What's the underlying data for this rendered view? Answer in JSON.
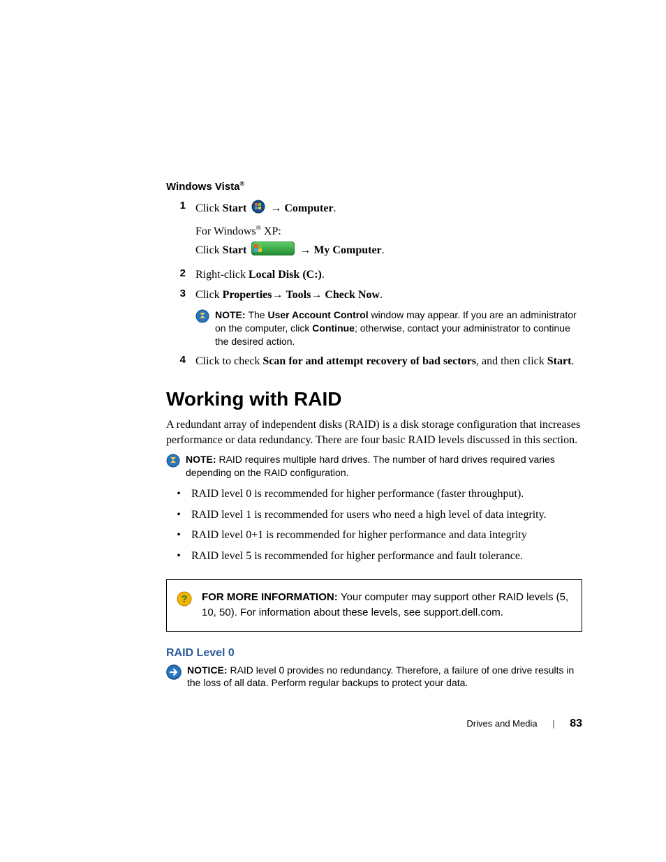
{
  "headings": {
    "vista": "Windows Vista",
    "vista_sup": "®",
    "raid_title": "Working with RAID",
    "raid_level0": "RAID Level 0"
  },
  "steps": {
    "s1": {
      "num": "1",
      "p1a": "Click ",
      "p1b": "Start",
      "p1c": " → ",
      "p1d": "Computer",
      "p1e": ".",
      "p2a": "For Windows",
      "p2sup": "®",
      "p2b": " XP:",
      "p3a": "Click ",
      "p3b": "Start",
      "p3c": " → ",
      "p3d": "My Computer",
      "p3e": "."
    },
    "s2": {
      "num": "2",
      "a": "Right-click ",
      "b": "Local Disk (C:)",
      "c": "."
    },
    "s3": {
      "num": "3",
      "a": "Click ",
      "b": "Properties",
      "c": "→ ",
      "d": "Tools",
      "e": "→ ",
      "f": "Check Now",
      "g": "."
    },
    "s4": {
      "num": "4",
      "a": "Click to check ",
      "b": "Scan for and attempt recovery of bad sectors",
      "c": ", and then click ",
      "d": "Start",
      "e": "."
    }
  },
  "note1": {
    "label": "NOTE: ",
    "a": "The ",
    "b": "User Account Control",
    "c": " window may appear. If you are an administrator on the computer, click ",
    "d": "Continue",
    "e": "; otherwise, contact your administrator to continue the desired action."
  },
  "raid_intro": "A redundant array of independent disks (RAID) is a disk storage configuration that increases performance or data redundancy. There are four basic RAID levels discussed in this section.",
  "note2": {
    "label": "NOTE: ",
    "text": "RAID requires multiple hard drives. The number of hard drives required varies depending on the RAID configuration."
  },
  "bullets": {
    "b1": "RAID level 0 is recommended for higher performance (faster throughput).",
    "b2": "RAID level 1 is recommended for users who need a high level of data integrity.",
    "b3": "RAID level 0+1 is recommended for higher performance and data integrity",
    "b4": "RAID level 5 is recommended for higher performance and fault tolerance."
  },
  "infobox": {
    "label": "FOR MORE INFORMATION: ",
    "text": "Your computer may support other RAID levels (5, 10, 50). For information about these levels, see support.dell.com."
  },
  "notice": {
    "label": "NOTICE: ",
    "text": "RAID level 0 provides no redundancy. Therefore, a failure of one drive results in the loss of all data. Perform regular backups to protect your data."
  },
  "footer": {
    "section": "Drives and Media",
    "page": "83"
  }
}
